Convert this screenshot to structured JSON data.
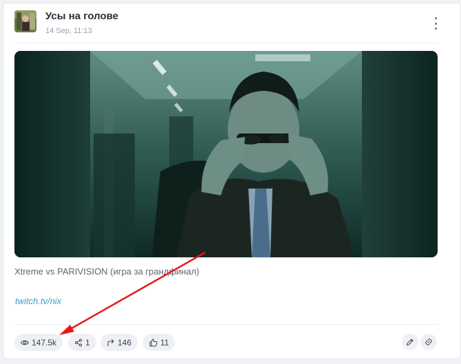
{
  "post": {
    "channel_name": "Усы на голове",
    "date": "14 Sep, 11:13",
    "caption": "Xtreme vs PARIVISION (игра за грандфинал)",
    "link_text": "twitch.tv/nix"
  },
  "stats": {
    "views": "147.5k",
    "shares": "1",
    "forwards": "146",
    "likes": "11"
  },
  "icons": {
    "views": "eye-icon",
    "shares": "share-icon",
    "forwards": "forward-arrow-icon",
    "likes": "thumbs-up-icon",
    "edit": "pencil-icon",
    "copy_link": "link-icon",
    "menu": "more-vertical-icon"
  },
  "colors": {
    "link": "#3aa1c6",
    "annotation_arrow": "#e31919"
  }
}
